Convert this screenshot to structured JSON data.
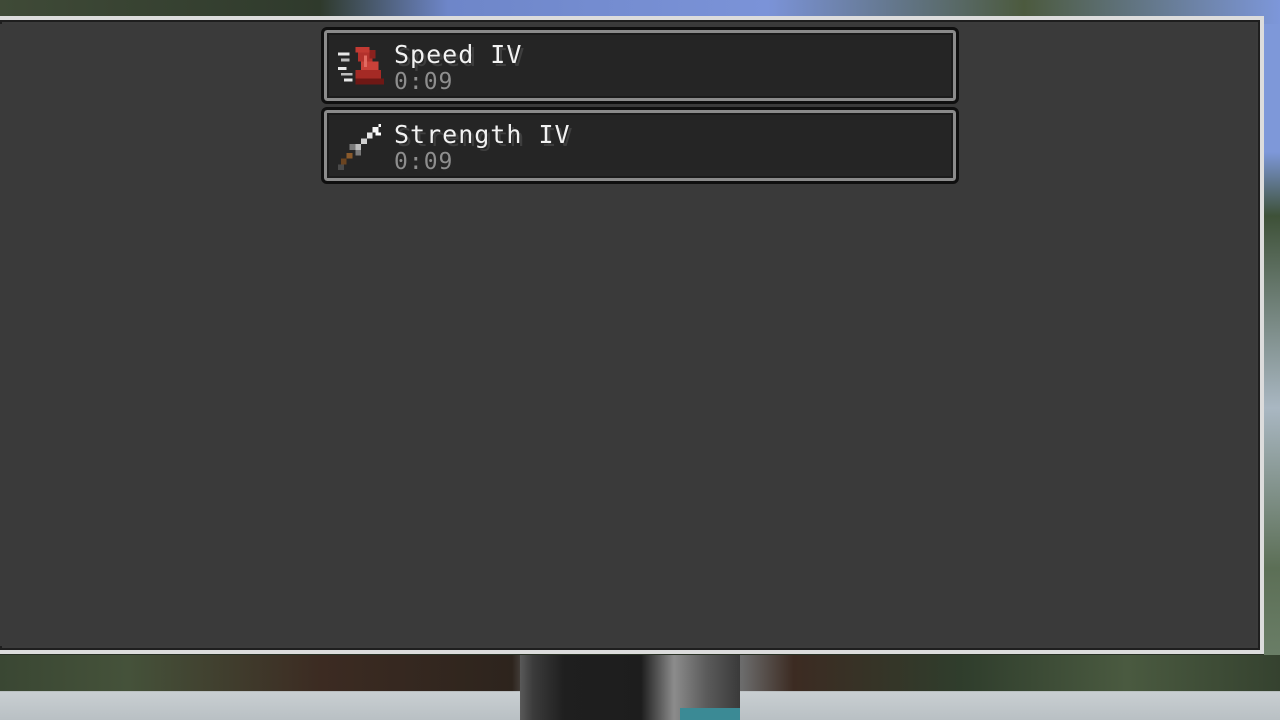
{
  "effects": [
    {
      "name": "Speed IV",
      "duration": "0:09",
      "icon": "speed-boot-icon",
      "icon_color": "#b3312c"
    },
    {
      "name": "Strength IV",
      "duration": "0:09",
      "icon": "strength-sword-icon",
      "icon_color": "#cfcfcf"
    }
  ],
  "colors": {
    "panel_background": "#3a3a3a",
    "entry_background": "#252525",
    "window_border": "#dcdcdc",
    "name_text": "#f2f2f2",
    "duration_text": "#8e8e8e"
  }
}
